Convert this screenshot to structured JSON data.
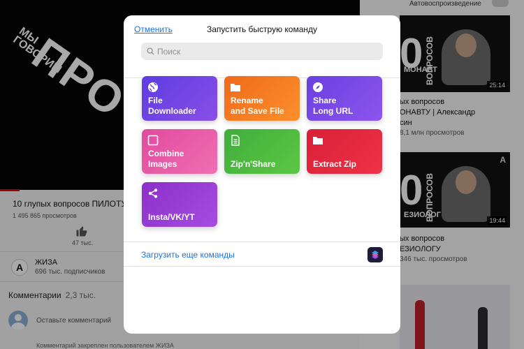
{
  "background": {
    "video": {
      "art_small": "МЫ ГОВОРИМ",
      "art_big": "ПРО",
      "title": "10 глупых вопросов ПИЛОТУ",
      "views": "1 495 865 просмотров",
      "likes": "47 тыс."
    },
    "channel": {
      "avatar_letter": "A",
      "name": "ЖИЗА",
      "subscribers": "696 тыс. подписчиков"
    },
    "comments": {
      "label": "Комментарии",
      "count": "2,3 тыс.",
      "placeholder": "Оставьте комментарий",
      "pinned": "Комментарий закреплен пользователем ЖИЗА"
    },
    "sidebar": {
      "autoplay_label": "Автовоспроизведение",
      "items": [
        {
          "thumb_num": "0",
          "thumb_word": "ВОПРОСОВ",
          "thumb_caption": "МОНАВТ",
          "duration": "25:14",
          "title_line1": "ых вопросов",
          "title_line2": "ОНАВТУ | Александр",
          "title_line3": "син",
          "meta": "8,1 млн просмотров"
        },
        {
          "thumb_num": "0",
          "thumb_word": "ВОПРОСОВ",
          "thumb_caption": "ЕЗИОЛОГ",
          "duration": "19:44",
          "title_line1": "ых вопросов",
          "title_line2": "ЕЗИОЛОГУ",
          "meta": "346 тыс. просмотров"
        }
      ]
    }
  },
  "modal": {
    "cancel_label": "Отменить",
    "title": "Запустить быструю команду",
    "search_placeholder": "Поиск",
    "tiles": [
      {
        "line1": "File",
        "line2": "Downloader",
        "icon": "globe-icon",
        "color_from": "#5c3ce0",
        "color_to": "#8a4fe8"
      },
      {
        "line1": "Rename",
        "line2": "and Save File",
        "icon": "folder-icon",
        "color_from": "#f06a1a",
        "color_to": "#fb8f2c"
      },
      {
        "line1": "Share",
        "line2": "Long URL",
        "icon": "compass-icon",
        "color_from": "#6a3fe0",
        "color_to": "#8c55ee"
      },
      {
        "line1": "Combine",
        "line2": "Images",
        "icon": "square-icon",
        "color_from": "#e24a9e",
        "color_to": "#ef6fb2"
      },
      {
        "line1": "Zip'n'Share",
        "line2": "",
        "icon": "document-icon",
        "color_from": "#3fae3a",
        "color_to": "#5cc645"
      },
      {
        "line1": "Extract Zip",
        "line2": "",
        "icon": "folder-icon",
        "color_from": "#d81f35",
        "color_to": "#ef3348"
      },
      {
        "line1": "Insta/VK/YT",
        "line2": "",
        "icon": "share-icon",
        "color_from": "#8b2fc9",
        "color_to": "#a64de0"
      }
    ],
    "more_link": "Загрузить еще команды"
  }
}
